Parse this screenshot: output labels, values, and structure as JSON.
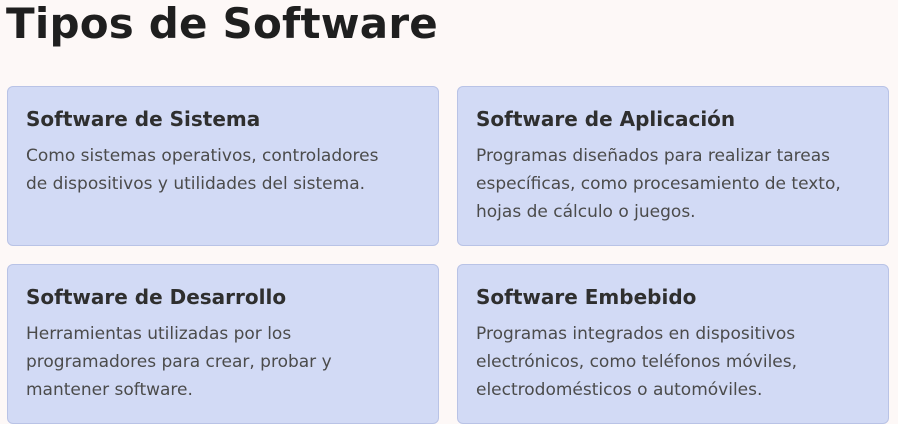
{
  "page": {
    "title": "Tipos de Software"
  },
  "cards": [
    {
      "title": "Software de Sistema",
      "lines": [
        "Como sistemas operativos, controladores",
        "de dispositivos y utilidades del sistema."
      ]
    },
    {
      "title": "Software de Aplicación",
      "lines": [
        "Programas diseñados para realizar tareas",
        "específicas, como procesamiento de texto,",
        "hojas de cálculo o juegos."
      ]
    },
    {
      "title": "Software de Desarrollo",
      "lines": [
        "Herramientas utilizadas por los",
        "programadores para crear, probar y",
        "mantener software."
      ]
    },
    {
      "title": "Software Embebido",
      "lines": [
        "Programas integrados en dispositivos",
        "electrónicos, como teléfonos móviles,",
        "electrodomésticos o automóviles."
      ]
    }
  ],
  "colors": {
    "background": "#fdf8f7",
    "card_background": "#d2daf5",
    "card_border": "#b9c3e6",
    "title_text": "#1f1f1f",
    "card_title_text": "#2f2f2f",
    "body_text": "#4b4b4b"
  }
}
